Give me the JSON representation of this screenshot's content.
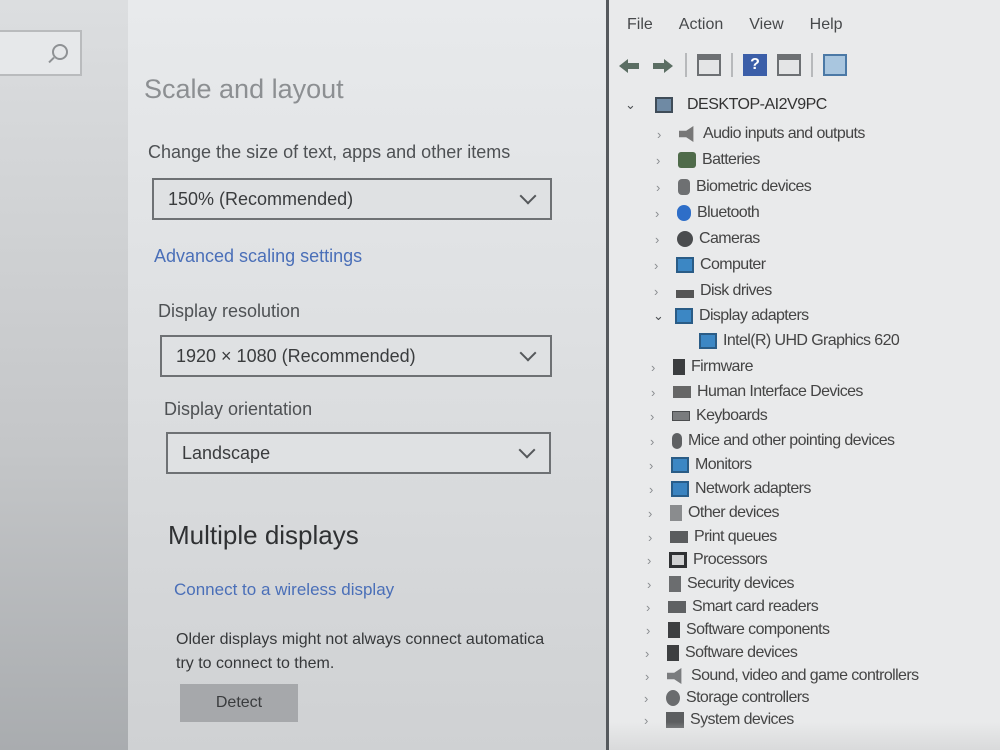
{
  "settings": {
    "heading": "Scale and layout",
    "scale_label": "Change the size of text, apps and other items",
    "scale_value": "150% (Recommended)",
    "advanced_scaling_link": "Advanced scaling settings",
    "resolution_label": "Display resolution",
    "resolution_value": "1920 × 1080 (Recommended)",
    "orientation_label": "Display orientation",
    "orientation_value": "Landscape",
    "multiple_heading": "Multiple displays",
    "wireless_link": "Connect to a wireless display",
    "older_text_line1": "Older displays might not always connect automatica",
    "older_text_line2": "try to connect to them.",
    "detect_button": "Detect"
  },
  "device_manager": {
    "menu": [
      "File",
      "Action",
      "View",
      "Help"
    ],
    "toolbar_icons": [
      "back-arrow-icon",
      "forward-arrow-icon",
      "properties-window-icon",
      "help-icon",
      "update-driver-icon",
      "scan-monitor-icon"
    ],
    "root": "DESKTOP-AI2V9PC",
    "items": [
      {
        "label": "Audio inputs and outputs",
        "icon": "speaker-icon",
        "expanded": false
      },
      {
        "label": "Batteries",
        "icon": "battery-icon",
        "expanded": false
      },
      {
        "label": "Biometric devices",
        "icon": "biometric-icon",
        "expanded": false
      },
      {
        "label": "Bluetooth",
        "icon": "bluetooth-icon",
        "expanded": false
      },
      {
        "label": "Cameras",
        "icon": "camera-icon",
        "expanded": false
      },
      {
        "label": "Computer",
        "icon": "monitor-icon",
        "expanded": false
      },
      {
        "label": "Disk drives",
        "icon": "disk-icon",
        "expanded": false
      },
      {
        "label": "Display adapters",
        "icon": "monitor-icon",
        "expanded": true
      },
      {
        "label": "Intel(R) UHD Graphics 620",
        "icon": "monitor-icon",
        "child": true
      },
      {
        "label": "Firmware",
        "icon": "chip-icon",
        "expanded": false
      },
      {
        "label": "Human Interface Devices",
        "icon": "hid-icon",
        "expanded": false
      },
      {
        "label": "Keyboards",
        "icon": "keyboard-icon",
        "expanded": false
      },
      {
        "label": "Mice and other pointing devices",
        "icon": "mouse-icon",
        "expanded": false
      },
      {
        "label": "Monitors",
        "icon": "monitor-icon",
        "expanded": false
      },
      {
        "label": "Network adapters",
        "icon": "network-icon",
        "expanded": false
      },
      {
        "label": "Other devices",
        "icon": "other-device-icon",
        "expanded": false
      },
      {
        "label": "Print queues",
        "icon": "printer-icon",
        "expanded": false
      },
      {
        "label": "Processors",
        "icon": "processor-icon",
        "expanded": false
      },
      {
        "label": "Security devices",
        "icon": "security-icon",
        "expanded": false
      },
      {
        "label": "Smart card readers",
        "icon": "card-reader-icon",
        "expanded": false
      },
      {
        "label": "Software components",
        "icon": "software-icon",
        "expanded": false
      },
      {
        "label": "Software devices",
        "icon": "software-icon",
        "expanded": false
      },
      {
        "label": "Sound, video and game controllers",
        "icon": "sound-icon",
        "expanded": false
      },
      {
        "label": "Storage controllers",
        "icon": "storage-icon",
        "expanded": false
      },
      {
        "label": "System devices",
        "icon": "system-icon",
        "expanded": false
      }
    ]
  }
}
